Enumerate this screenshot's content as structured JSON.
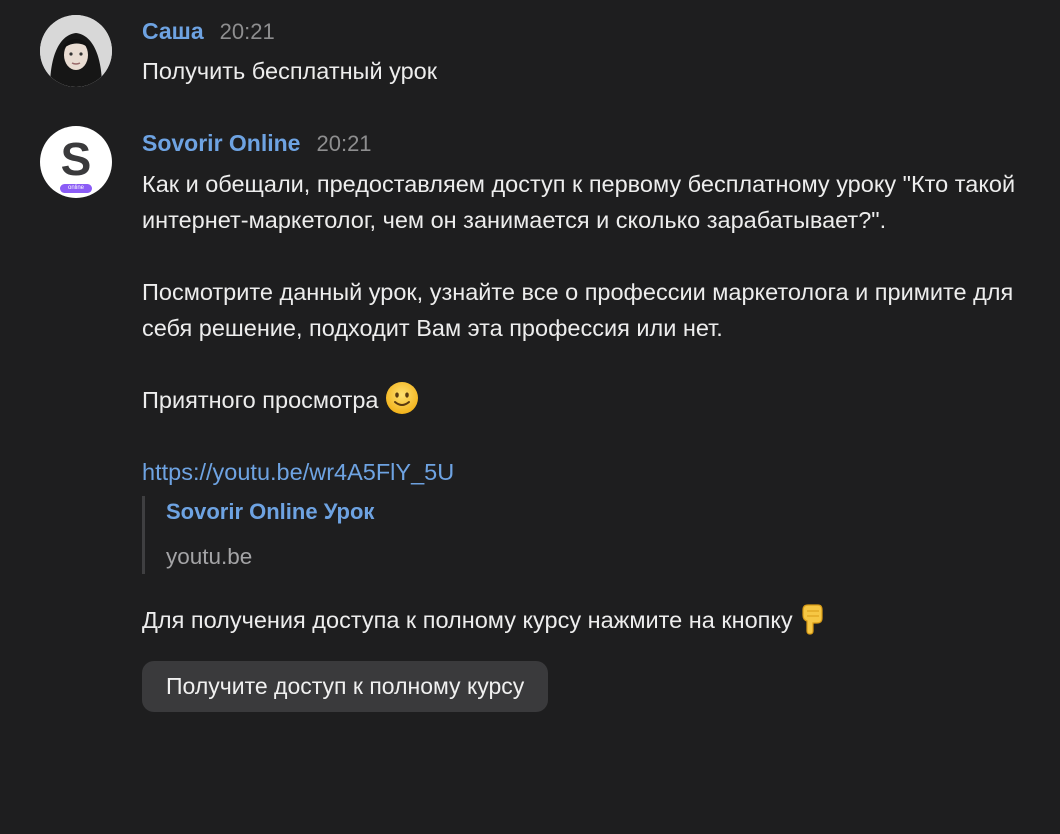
{
  "messages": [
    {
      "sender": "Саша",
      "time": "20:21",
      "text": "Получить бесплатный урок"
    },
    {
      "sender": "Sovorir Online",
      "time": "20:21",
      "avatar_letter": "S",
      "avatar_badge": "online",
      "paragraph1": "Как и обещали, предоставляем доступ к первому бесплатному уроку \"Кто такой интернет-маркетолог, чем он занимается и сколько зарабатывает?\".",
      "paragraph2": "Посмотрите данный урок, узнайте все о профессии маркетолога и примите для себя решение, подходит Вам эта профессия или нет.",
      "paragraph3": "Приятного просмотра",
      "link": "https://youtu.be/wr4A5FlY_5U",
      "preview": {
        "title": "Sovorir Online Урок",
        "site": "youtu.be"
      },
      "paragraph4": "Для получения доступа к полному курсу нажмите на кнопку",
      "button_label": "Получите доступ к полному курсу"
    }
  ],
  "colors": {
    "background": "#1e1e1f",
    "accent": "#6ea3e2",
    "button_bg": "#3a3a3c",
    "badge": "#8b5cf6"
  },
  "icons": {
    "smile": "slightly-smiling-face-emoji",
    "pointing": "backhand-index-pointing-down-emoji"
  }
}
